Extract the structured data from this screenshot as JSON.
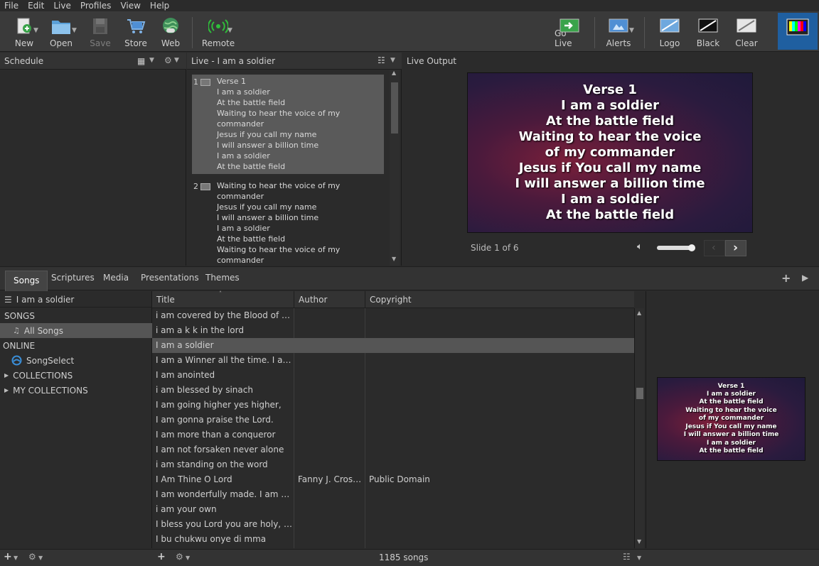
{
  "menu": [
    "File",
    "Edit",
    "Live",
    "Profiles",
    "View",
    "Help"
  ],
  "toolbar": {
    "new": "New",
    "open": "Open",
    "save": "Save",
    "store": "Store",
    "web": "Web",
    "remote": "Remote",
    "golive": "Go Live",
    "alerts": "Alerts",
    "logo": "Logo",
    "black": "Black",
    "clear": "Clear"
  },
  "schedule": {
    "title": "Schedule"
  },
  "live": {
    "title": "Live - I am a soldier",
    "slides": [
      {
        "num": "1",
        "lines": [
          "Verse 1",
          "I am a soldier",
          "At the battle field",
          "Waiting to hear the voice of my",
          "commander",
          "Jesus if you call my name",
          "I will answer a billion time",
          "I am a soldier",
          "At the battle field"
        ]
      },
      {
        "num": "2",
        "lines": [
          "Waiting to hear the voice of my",
          "commander",
          "Jesus if you call my name",
          "I will answer a billion time",
          "I am a soldier",
          "At the battle field",
          "Waiting to hear the voice of my",
          "commander"
        ]
      }
    ]
  },
  "liveoutput": {
    "title": "Live Output",
    "lines": [
      "Verse 1",
      "I am a soldier",
      "At the battle field",
      "Waiting to hear the voice",
      "of my commander",
      "Jesus if You call my name",
      "I will answer a billion time",
      "I am a soldier",
      "At the battle field"
    ],
    "slide_status": "Slide 1 of 6",
    "volume": 0.9
  },
  "tabs": [
    "Songs",
    "Scriptures",
    "Media",
    "Presentations",
    "Themes"
  ],
  "library": {
    "search": "I am a soldier",
    "songs_header": "SONGS",
    "all_songs": "All Songs",
    "online_header": "ONLINE",
    "songselect": "SongSelect",
    "collections": "COLLECTIONS",
    "my_collections": "MY COLLECTIONS"
  },
  "songlist": {
    "columns": [
      "Title",
      "Author",
      "Copyright"
    ],
    "rows": [
      {
        "title": "i  am covered by the Blood of Jesu...",
        "author": "",
        "copyright": ""
      },
      {
        "title": "i am a k k in the lord",
        "author": "",
        "copyright": ""
      },
      {
        "title": "I am a soldier",
        "author": "",
        "copyright": "",
        "selected": true
      },
      {
        "title": "I am a Winner all the time. I am a s...",
        "author": "",
        "copyright": ""
      },
      {
        "title": "I am anointed",
        "author": "",
        "copyright": ""
      },
      {
        "title": "i am blessed by sinach",
        "author": "",
        "copyright": ""
      },
      {
        "title": "I am going higher yes higher,",
        "author": "",
        "copyright": ""
      },
      {
        "title": "I am gonna praise the Lord.",
        "author": "",
        "copyright": ""
      },
      {
        "title": "I am more than a conqueror",
        "author": "",
        "copyright": ""
      },
      {
        "title": "I am not forsaken never alone",
        "author": "",
        "copyright": ""
      },
      {
        "title": "i am standing on the word",
        "author": "",
        "copyright": ""
      },
      {
        "title": "I Am Thine O Lord",
        "author": "Fanny J. Crosby...",
        "copyright": "Public Domain"
      },
      {
        "title": "I am wonderfully made. I am praye...",
        "author": "",
        "copyright": ""
      },
      {
        "title": "i am your own",
        "author": "",
        "copyright": ""
      },
      {
        "title": "I bless you Lord you are holy, ho",
        "author": "",
        "copyright": ""
      },
      {
        "title": "I bu chukwu onye di mma",
        "author": "",
        "copyright": ""
      }
    ],
    "count": "1185 songs"
  },
  "smallpreview": {
    "lines": [
      "Verse 1",
      "I am a soldier",
      "At the battle field",
      "Waiting to hear the voice",
      "of my commander",
      "Jesus if You call my name",
      "I will answer a billion time",
      "I am a soldier",
      "At the battle field"
    ]
  },
  "colors": {
    "accent": "#1f5fa0",
    "background": "#2b2b2b",
    "selected_row": "#555555"
  }
}
